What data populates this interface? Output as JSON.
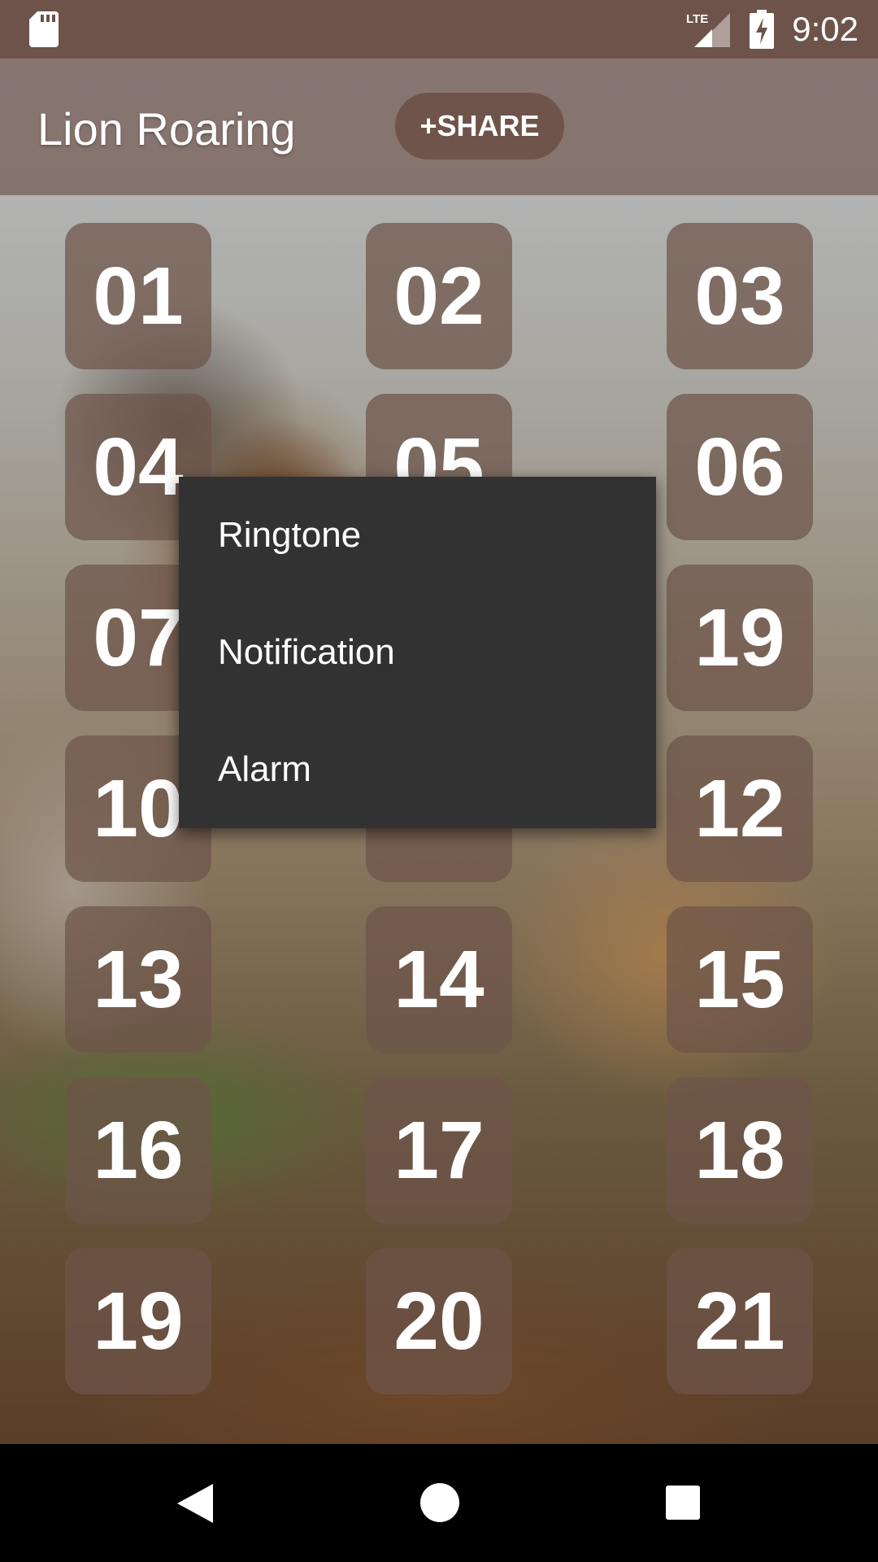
{
  "status_bar": {
    "time": "9:02",
    "network": "LTE",
    "icons": [
      "sd-card-icon",
      "lte-signal-icon",
      "battery-charging-icon"
    ]
  },
  "app_bar": {
    "title": "Lion Roaring",
    "share_label": "+SHARE"
  },
  "tiles": [
    "01",
    "02",
    "03",
    "04",
    "05",
    "06",
    "07",
    "19",
    "10",
    "12",
    "13",
    "14",
    "15",
    "16",
    "17",
    "18",
    "19",
    "20",
    "21"
  ],
  "popup_menu": {
    "items": [
      "Ringtone",
      "Notification",
      "Alarm"
    ]
  },
  "colors": {
    "status_bar": "#6d5349",
    "tile": "#6e544a",
    "popup_bg": "#323232",
    "nav_bar": "#000000"
  },
  "nav_bar": {
    "icons": [
      "back-icon",
      "home-icon",
      "recents-icon"
    ]
  }
}
